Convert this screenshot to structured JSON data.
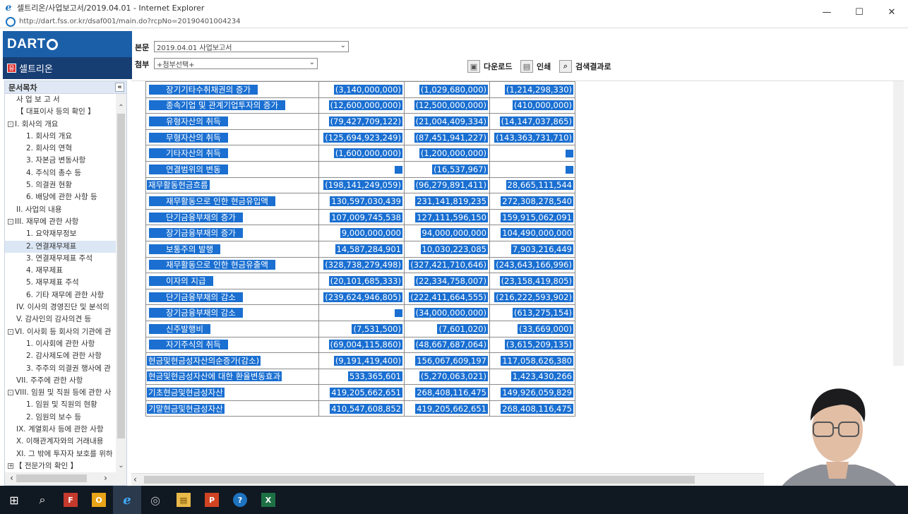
{
  "window": {
    "title": "셀트리온/사업보고서/2019.04.01 - Internet Explorer",
    "url": "http://dart.fss.or.kr/dsaf001/main.do?rcpNo=20190401004234",
    "min": "—",
    "max": "☐",
    "close": "✕"
  },
  "header": {
    "logo": "DART",
    "company": "셀트리온",
    "report_label": "본문",
    "report_value": "2019.04.01  사업보고서",
    "attach_label": "첨부",
    "attach_value": "+첨부선택+",
    "download": "다운로드",
    "print": "인쇄",
    "search_results": "검색결과로"
  },
  "sidebar": {
    "title": "문서목차",
    "items": [
      {
        "label": "사 업 보 고 서",
        "indent": 1
      },
      {
        "label": "【 대표이사 등의 확인 】",
        "indent": 1
      },
      {
        "label": "I. 회사의 개요",
        "indent": 0,
        "toggle": "-"
      },
      {
        "label": "1. 회사의 개요",
        "indent": 2
      },
      {
        "label": "2. 회사의 연혁",
        "indent": 2
      },
      {
        "label": "3. 자본금 변동사항",
        "indent": 2
      },
      {
        "label": "4. 주식의 총수 등",
        "indent": 2
      },
      {
        "label": "5. 의결권 현황",
        "indent": 2
      },
      {
        "label": "6. 배당에 관한 사항 등",
        "indent": 2
      },
      {
        "label": "II. 사업의 내용",
        "indent": 1
      },
      {
        "label": "III. 재무에 관한 사항",
        "indent": 0,
        "toggle": "-"
      },
      {
        "label": "1. 요약재무정보",
        "indent": 2
      },
      {
        "label": "2. 연결재무제표",
        "indent": 2,
        "selected": true
      },
      {
        "label": "3. 연결재무제표 주석",
        "indent": 2
      },
      {
        "label": "4. 재무제표",
        "indent": 2
      },
      {
        "label": "5. 재무제표 주석",
        "indent": 2
      },
      {
        "label": "6. 기타 재무에 관한 사항",
        "indent": 2
      },
      {
        "label": "IV. 이사의 경영진단 및 분석의",
        "indent": 1
      },
      {
        "label": "V. 감사인의 감사의견 등",
        "indent": 1
      },
      {
        "label": "VI. 이사회 등 회사의 기관에 관",
        "indent": 0,
        "toggle": "-"
      },
      {
        "label": "1. 이사회에 관한 사항",
        "indent": 2
      },
      {
        "label": "2. 감사제도에 관한 사항",
        "indent": 2
      },
      {
        "label": "3. 주주의 의결권 행사에 관",
        "indent": 2
      },
      {
        "label": "VII. 주주에 관한 사항",
        "indent": 1
      },
      {
        "label": "VIII. 임원 및 직원 등에 관한 사",
        "indent": 0,
        "toggle": "-"
      },
      {
        "label": "1. 임원 및 직원의 현황",
        "indent": 2
      },
      {
        "label": "2. 임원의 보수 등",
        "indent": 2
      },
      {
        "label": "IX. 계열회사 등에 관한 사항",
        "indent": 1
      },
      {
        "label": "X. 이해관계자와의 거래내용",
        "indent": 1
      },
      {
        "label": "XI. 그 밖에 투자자 보호를 위하",
        "indent": 1
      },
      {
        "label": "【 전문가의 확인 】",
        "indent": 0,
        "toggle": "+"
      }
    ]
  },
  "table": {
    "rows": [
      {
        "label": "장기기타수취채권의 증가",
        "indent": true,
        "v": [
          "(3,140,000,000)",
          "(1,029,680,000)",
          "(1,214,298,330)"
        ]
      },
      {
        "label": "종속기업 및 관계기업투자의 증가",
        "indent": true,
        "v": [
          "(12,600,000,000)",
          "(12,500,000,000)",
          "(410,000,000)"
        ]
      },
      {
        "label": "유형자산의 취득",
        "indent": true,
        "v": [
          "(79,427,709,122)",
          "(21,004,409,334)",
          "(14,147,037,865)"
        ]
      },
      {
        "label": "무형자산의 취득",
        "indent": true,
        "v": [
          "(125,694,923,249)",
          "(87,451,941,227)",
          "(143,363,731,710)"
        ]
      },
      {
        "label": "기타자산의 취득",
        "indent": true,
        "v": [
          "(1,600,000,000)",
          "(1,200,000,000)",
          ""
        ]
      },
      {
        "label": "연결범위의 변동",
        "indent": true,
        "v": [
          "",
          "(16,537,967)",
          ""
        ]
      },
      {
        "label": "재무활동현금흐름",
        "indent": false,
        "v": [
          "(198,141,249,059)",
          "(96,279,891,411)",
          "28,665,111,544"
        ]
      },
      {
        "label": "재무활동으로 인한 현금유입액",
        "indent": true,
        "v": [
          "130,597,030,439",
          "231,141,819,235",
          "272,308,278,540"
        ]
      },
      {
        "label": "단기금융부채의 증가",
        "indent": true,
        "v": [
          "107,009,745,538",
          "127,111,596,150",
          "159,915,062,091"
        ]
      },
      {
        "label": "장기금융부채의 증가",
        "indent": true,
        "v": [
          "9,000,000,000",
          "94,000,000,000",
          "104,490,000,000"
        ]
      },
      {
        "label": "보통주의 발행",
        "indent": true,
        "v": [
          "14,587,284,901",
          "10,030,223,085",
          "7,903,216,449"
        ]
      },
      {
        "label": "재무활동으로 인한 현금유출액",
        "indent": true,
        "v": [
          "(328,738,279,498)",
          "(327,421,710,646)",
          "(243,643,166,996)"
        ]
      },
      {
        "label": "이자의 지급",
        "indent": true,
        "v": [
          "(20,101,685,333)",
          "(22,334,758,007)",
          "(23,158,419,805)"
        ]
      },
      {
        "label": "단기금융부채의 감소",
        "indent": true,
        "v": [
          "(239,624,946,805)",
          "(222,411,664,555)",
          "(216,222,593,902)"
        ]
      },
      {
        "label": "장기금융부채의 감소",
        "indent": true,
        "v": [
          "",
          "(34,000,000,000)",
          "(613,275,154)"
        ]
      },
      {
        "label": "신주발행비",
        "indent": true,
        "v": [
          "(7,531,500)",
          "(7,601,020)",
          "(33,669,000)"
        ]
      },
      {
        "label": "자기주식의 취득",
        "indent": true,
        "v": [
          "(69,004,115,860)",
          "(48,667,687,064)",
          "(3,615,209,135)"
        ]
      },
      {
        "label": "현금및현금성자산의순증가(감소)",
        "indent": false,
        "v": [
          "(9,191,419,400)",
          "156,067,609,197",
          "117,058,626,380"
        ]
      },
      {
        "label": "현금및현금성자산에 대한 환율변동효과",
        "indent": false,
        "v": [
          "533,365,601",
          "(5,270,063,021)",
          "1,423,430,266"
        ]
      },
      {
        "label": "기초현금및현금성자산",
        "indent": false,
        "v": [
          "419,205,662,651",
          "268,408,116,475",
          "149,926,059,829"
        ]
      },
      {
        "label": "기말현금및현금성자산",
        "indent": false,
        "v": [
          "410,547,608,852",
          "419,205,662,651",
          "268,408,116,475"
        ]
      }
    ]
  },
  "taskbar": {
    "start": "⊞",
    "search": "⌕",
    "apps": [
      "F",
      "O",
      "e",
      "◎",
      "▤",
      "P",
      "?",
      "X"
    ]
  }
}
